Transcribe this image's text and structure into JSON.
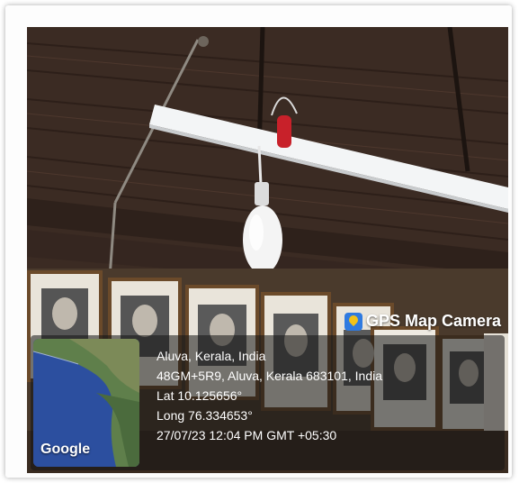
{
  "overlay": {
    "brand_label": "GPS Map Camera",
    "brand_icon": "gps-map-camera-icon",
    "map_attribution": "Google",
    "location_title": "Aluva, Kerala, India",
    "address": "48GM+5R9, Aluva, Kerala 683101, India",
    "latitude": "Lat 10.125656°",
    "longitude": "Long 76.334653°",
    "timestamp": "27/07/23 12:04 PM GMT +05:30"
  }
}
